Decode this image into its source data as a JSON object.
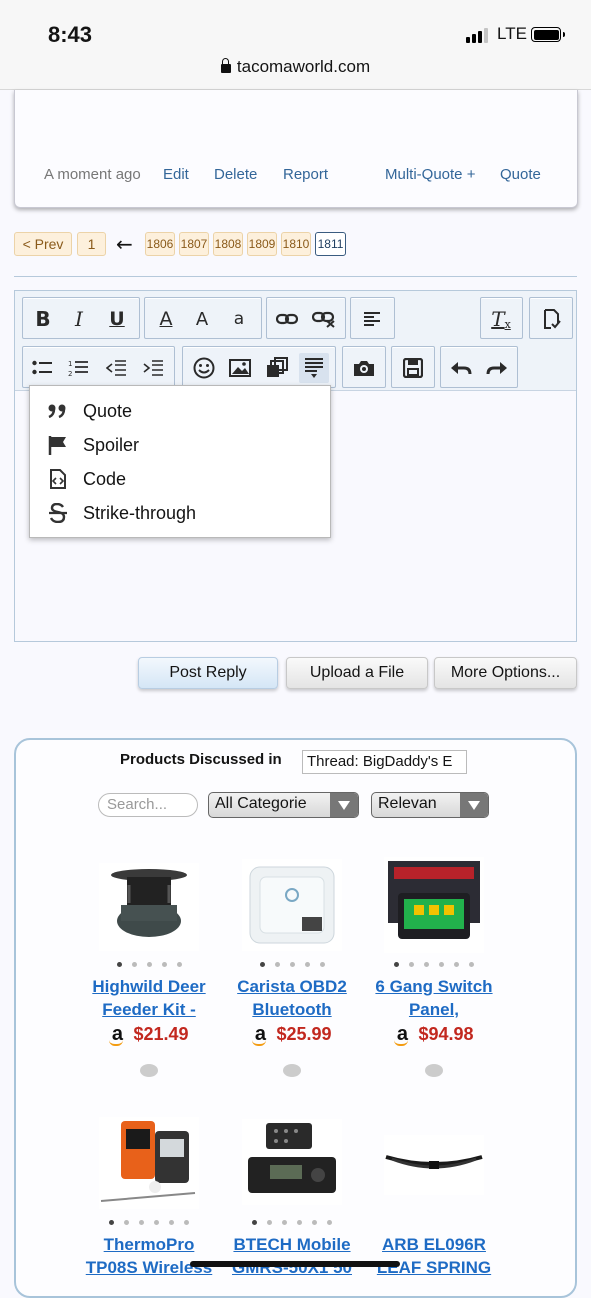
{
  "status": {
    "time": "8:43",
    "network": "LTE",
    "url": "tacomaworld.com"
  },
  "post": {
    "time": "A moment ago",
    "edit": "Edit",
    "delete": "Delete",
    "report": "Report",
    "multiquote": "Multi-Quote +",
    "quote": "Quote"
  },
  "pagination": {
    "prev": "< Prev",
    "first": "1",
    "arrow": "←",
    "pages": [
      "1806",
      "1807",
      "1808",
      "1809",
      "1810",
      "1811"
    ],
    "current": "1811"
  },
  "toolbar": {
    "row1": [
      "bold-icon",
      "italic-icon",
      "underline-icon",
      "text-color-icon",
      "font-size-icon",
      "font-family-icon",
      "link-icon",
      "unlink-icon",
      "align-icon",
      "remove-format-icon",
      "toggle-bbcode-icon"
    ],
    "row2": [
      "bullet-list-icon",
      "numbered-list-icon",
      "outdent-icon",
      "indent-icon",
      "smilie-icon",
      "image-icon",
      "media-icon",
      "insert-menu-icon",
      "camera-icon",
      "save-draft-icon",
      "undo-icon",
      "redo-icon"
    ],
    "bold": "B",
    "italic": "I",
    "underline": "U",
    "textcolor": "A",
    "fontsize": "A",
    "fontfam": "a",
    "removefmt": "T"
  },
  "insert_menu": {
    "items": [
      {
        "icon": "quote-icon",
        "label": "Quote"
      },
      {
        "icon": "flag-icon",
        "label": "Spoiler"
      },
      {
        "icon": "code-icon",
        "label": "Code"
      },
      {
        "icon": "strikethrough-icon",
        "label": "Strike-through"
      }
    ]
  },
  "buttons": {
    "post_reply": "Post Reply",
    "upload": "Upload a File",
    "more": "More Options..."
  },
  "products": {
    "title": "Products Discussed in",
    "thread": "Thread: BigDaddy's E",
    "search_placeholder": "Search...",
    "category": "All Categorie",
    "sort": "Relevan",
    "items": [
      {
        "name1": "Highwild Deer",
        "name2": "Feeder Kit -",
        "price": "$21.49",
        "amazon": "a",
        "dots": 5,
        "active": 0
      },
      {
        "name1": "Carista OBD2",
        "name2": "Bluetooth",
        "price": "$25.99",
        "amazon": "a",
        "dots": 5,
        "active": 0
      },
      {
        "name1": "6 Gang Switch",
        "name2": "Panel,",
        "price": "$94.98",
        "amazon": "a",
        "dots": 6,
        "active": 0
      },
      {
        "name1": "ThermoPro",
        "name2": "TP08S Wireless",
        "dots": 6,
        "active": 0
      },
      {
        "name1": "BTECH Mobile",
        "name2": "GMRS-50X1 50",
        "dots": 6,
        "active": 0
      },
      {
        "name1": "ARB EL096R",
        "name2": "LEAF SPRING",
        "dots": 0,
        "active": 0
      }
    ]
  }
}
